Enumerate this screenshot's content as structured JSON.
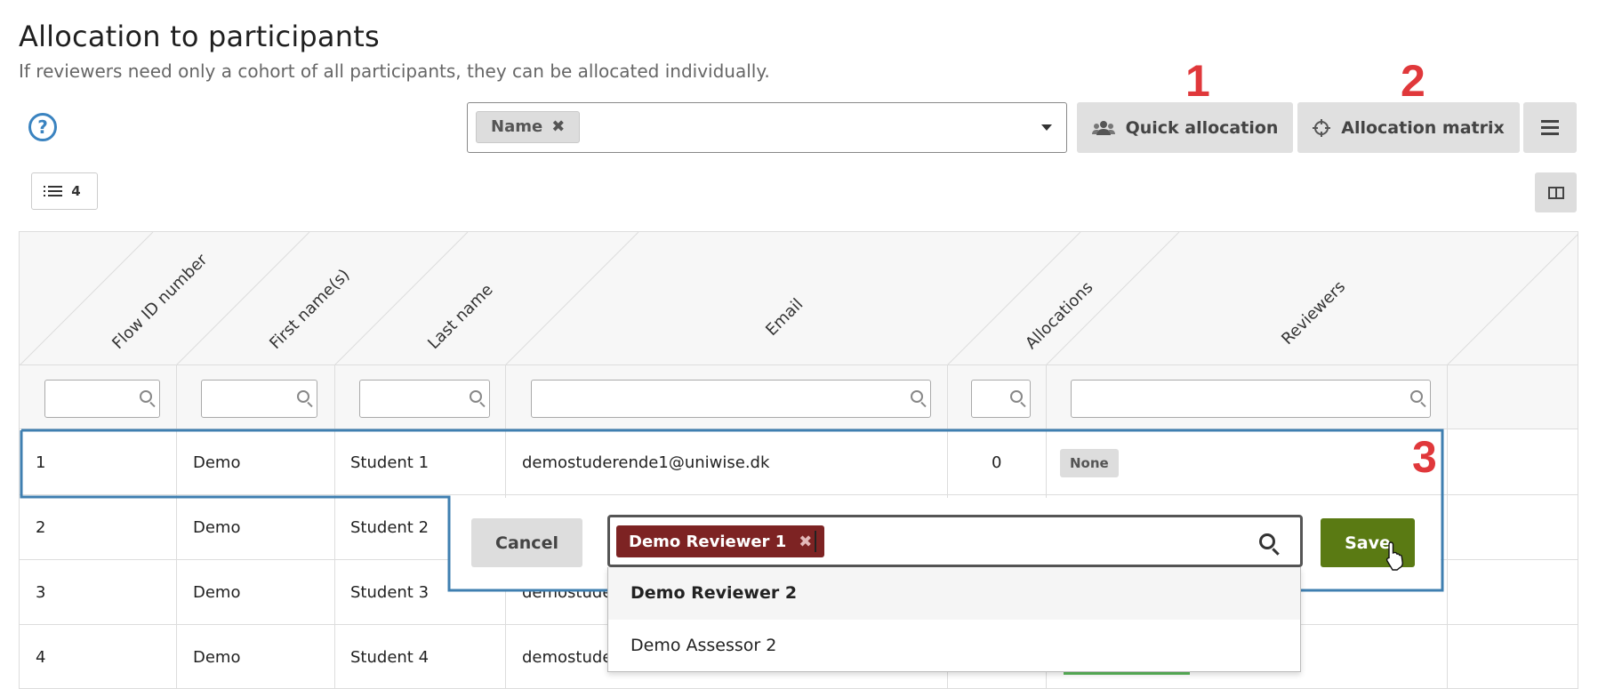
{
  "page": {
    "title": "Allocation to participants",
    "subtitle": "If reviewers need only a cohort of all participants, they can be allocated individually."
  },
  "toolbar": {
    "help_icon": "?",
    "group_by_chip": "Name",
    "quick_allocation_label": "Quick allocation",
    "allocation_matrix_label": "Allocation matrix",
    "row_count": "4"
  },
  "annotations": {
    "one": "1",
    "two": "2",
    "three": "3"
  },
  "table": {
    "columns": [
      "Flow ID number",
      "First name(s)",
      "Last name",
      "Email",
      "Allocations",
      "Reviewers"
    ],
    "rows": [
      {
        "id": "1",
        "first": "Demo",
        "last": "Student 1",
        "email": "demostuderende1@uniwise.dk",
        "allocations": "0",
        "reviewers": "None"
      },
      {
        "id": "2",
        "first": "Demo",
        "last": "Student 2",
        "email": "",
        "allocations": "",
        "reviewers": ""
      },
      {
        "id": "3",
        "first": "Demo",
        "last": "Student 3",
        "email": "demostude",
        "allocations": "",
        "reviewers": ""
      },
      {
        "id": "4",
        "first": "Demo",
        "last": "Student 4",
        "email": "demostude",
        "allocations": "",
        "reviewers": ""
      }
    ]
  },
  "editor": {
    "cancel_label": "Cancel",
    "save_label": "Save",
    "selected_reviewer": "Demo Reviewer 1",
    "options": [
      "Demo Reviewer 2",
      "Demo Assessor 2"
    ]
  },
  "colors": {
    "accent_blue": "#3a83c0",
    "annotation_red": "#e0383b",
    "save_green": "#5a7a13",
    "reviewer_chip": "#7d2323"
  },
  "icons": [
    "help-icon",
    "users-icon",
    "crosshair-icon",
    "hamburger-icon",
    "list-icon",
    "columns-icon",
    "search-icon",
    "close-icon",
    "chevron-down-icon",
    "pointer-cursor-icon"
  ]
}
